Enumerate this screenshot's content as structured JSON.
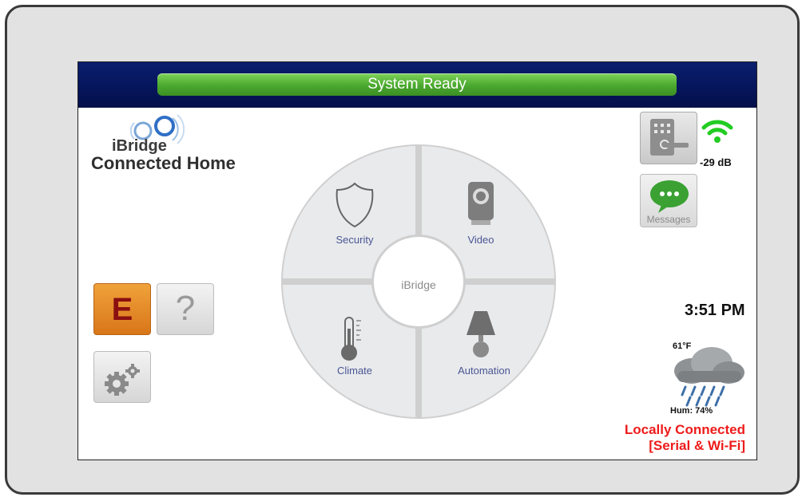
{
  "status_bar": {
    "text": "System Ready"
  },
  "logo": {
    "brand": "iBridge",
    "subtitle": "Connected Home"
  },
  "left_buttons": {
    "e_label": "E",
    "help_label": "?",
    "settings_icon": "gear-icon"
  },
  "wheel": {
    "center": "iBridge",
    "security": "Security",
    "video": "Video",
    "climate": "Climate",
    "automation": "Automation"
  },
  "right_panel": {
    "signal": "-29 dB",
    "messages_label": "Messages",
    "time": "3:51 PM",
    "temperature": "61°F",
    "humidity": "Hum: 74%",
    "connection_line1": "Locally Connected",
    "connection_line2": "[Serial & Wi-Fi]"
  },
  "colors": {
    "status_green": "#4aa82e",
    "header_navy": "#06145a",
    "connection_red": "#ee1b1b",
    "wifi_green": "#22cc22",
    "e_button_orange": "#e88a2a"
  }
}
